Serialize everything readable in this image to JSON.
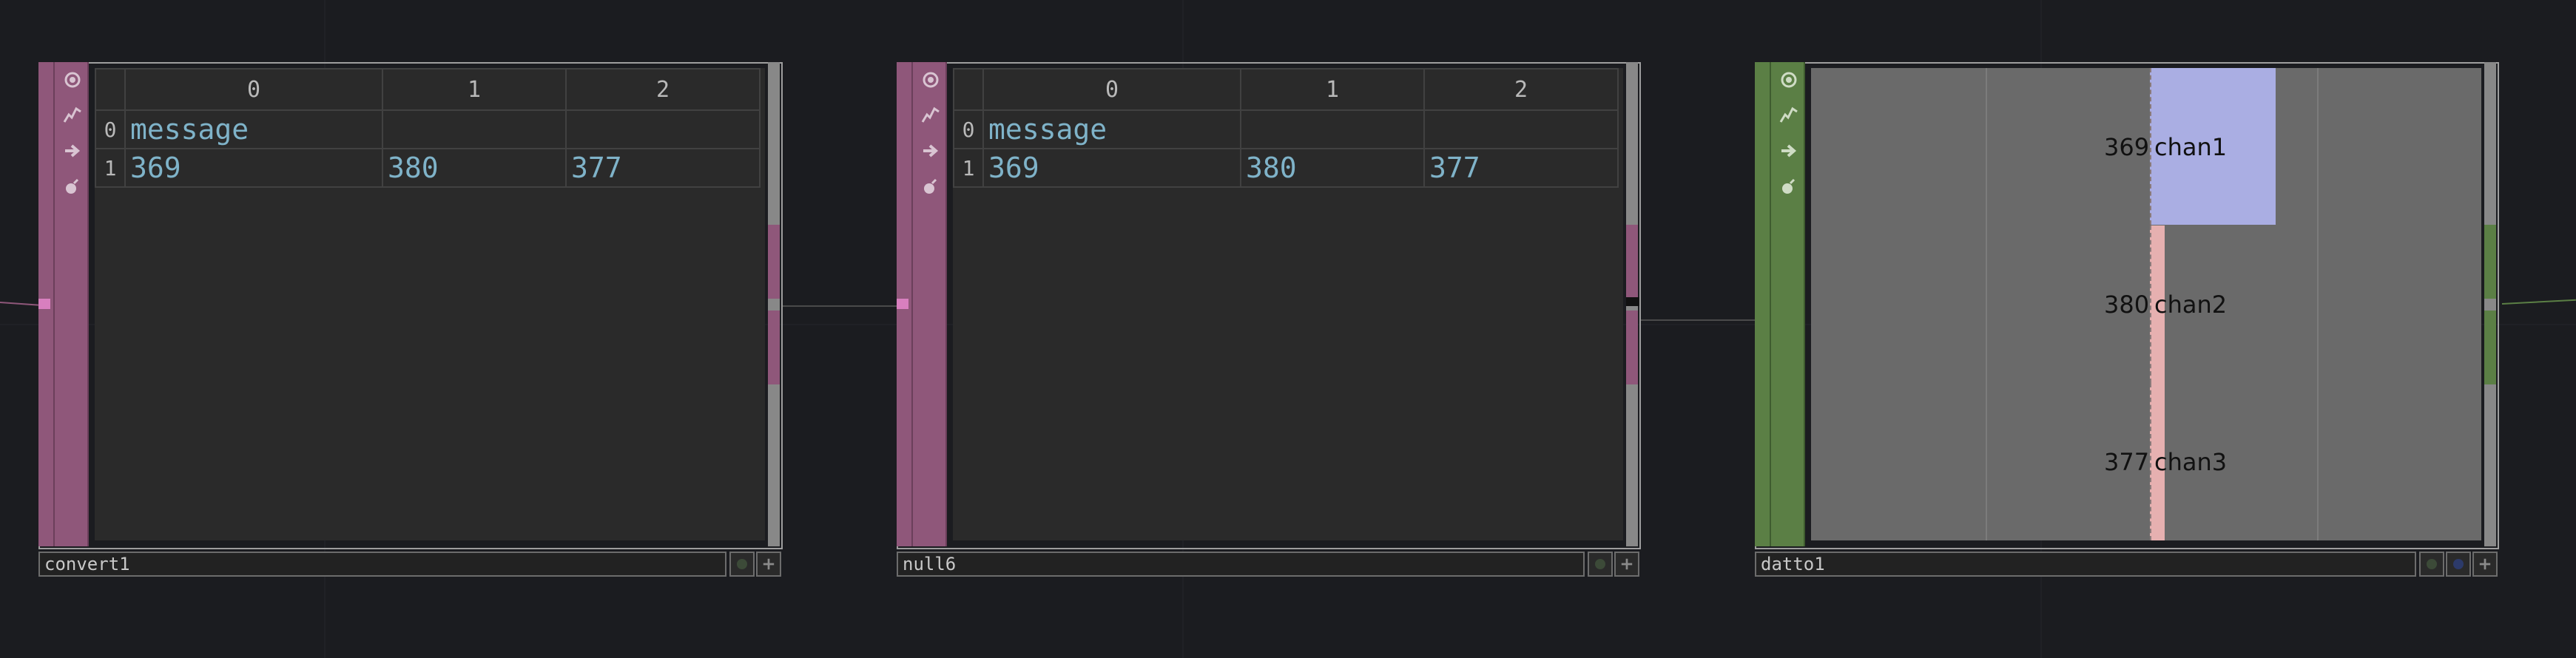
{
  "nodes": {
    "convert1": {
      "name": "convert1",
      "columns": [
        "0",
        "1",
        "2"
      ],
      "rows": [
        {
          "index": "0",
          "cells": [
            "message",
            "",
            ""
          ]
        },
        {
          "index": "1",
          "cells": [
            "369",
            "380",
            "377"
          ]
        }
      ]
    },
    "null6": {
      "name": "null6",
      "columns": [
        "0",
        "1",
        "2"
      ],
      "rows": [
        {
          "index": "0",
          "cells": [
            "message",
            "",
            ""
          ]
        },
        {
          "index": "1",
          "cells": [
            "369",
            "380",
            "377"
          ]
        }
      ]
    },
    "datto1": {
      "name": "datto1",
      "chart_data": {
        "type": "bar",
        "orientation": "horizontal",
        "categories": [
          "chan1",
          "chan2",
          "chan3"
        ],
        "values": [
          369,
          380,
          377
        ],
        "value_labels": [
          "369",
          "380",
          "377"
        ]
      }
    }
  },
  "colors": {
    "dat_family": "#8f577a",
    "chop_family": "#5b7f45",
    "cell_text": "#7fb3c9",
    "chan1_bar": "#aaaee3",
    "chan2_bar": "#e6b0b0"
  },
  "icons": [
    "target-icon",
    "pulse-icon",
    "arrow-right-icon",
    "bomb-icon"
  ]
}
